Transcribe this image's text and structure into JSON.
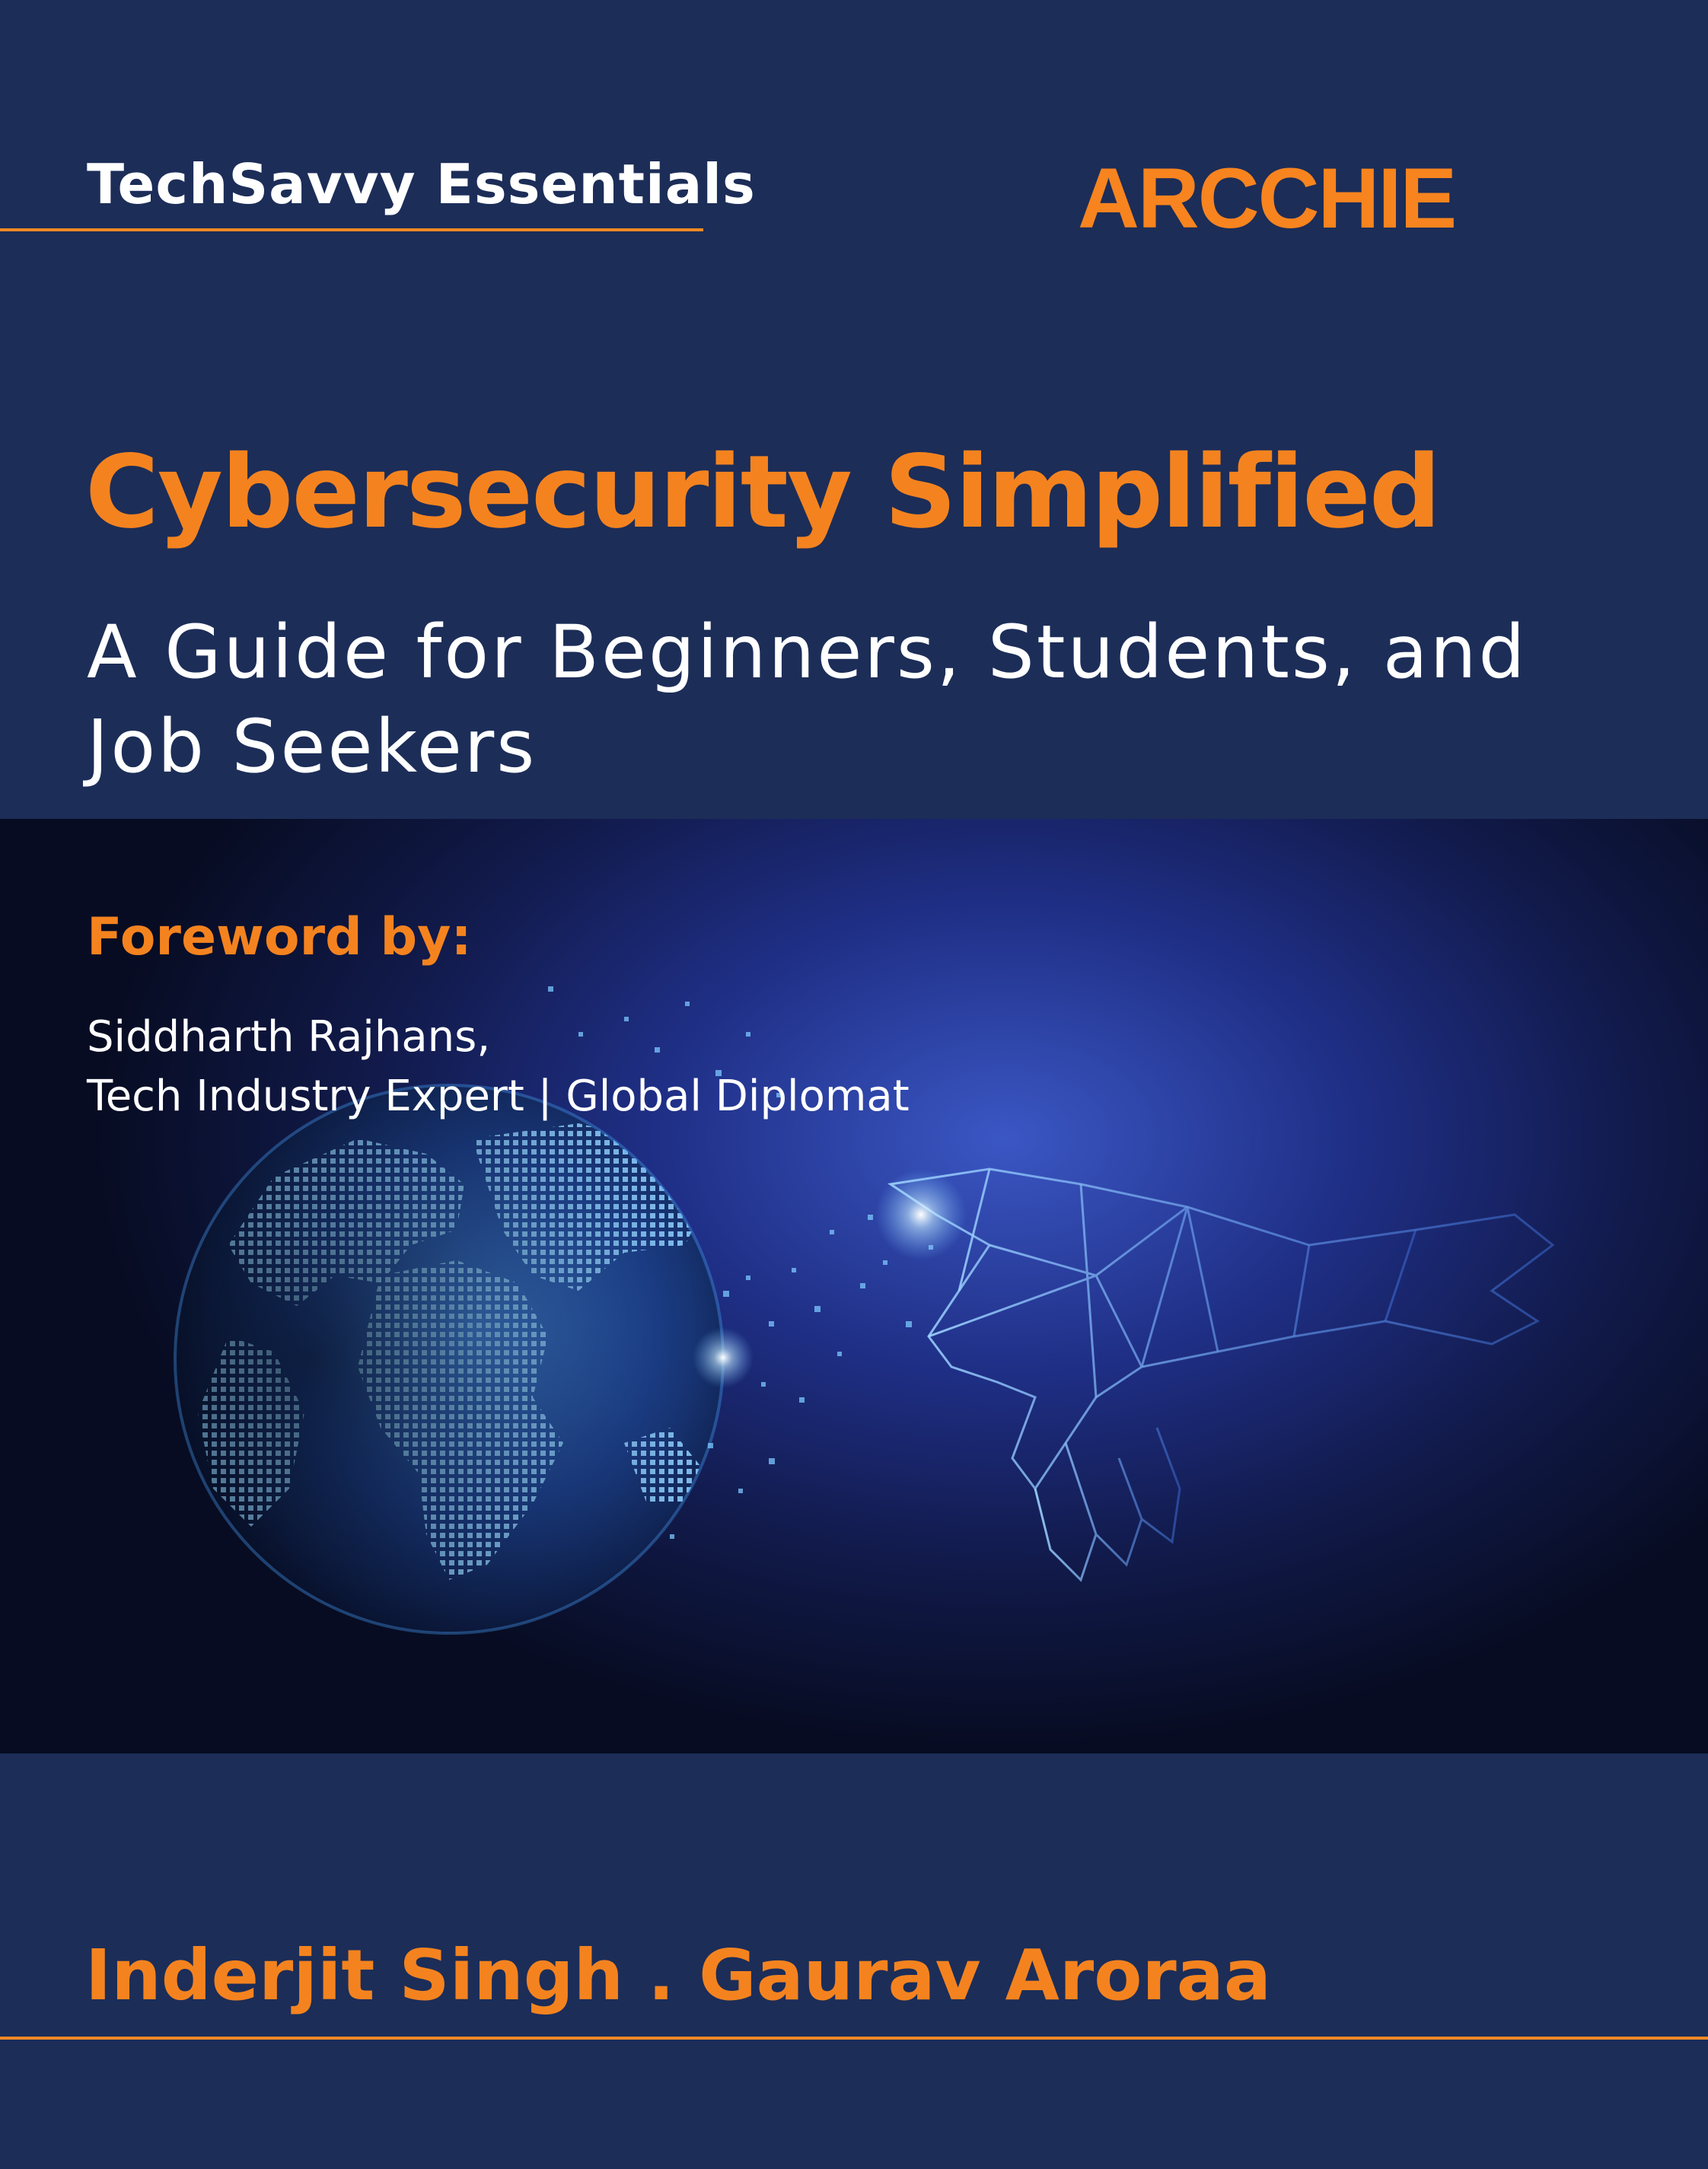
{
  "cover": {
    "series": "TechSavvy Essentials",
    "publisher": "ARCCHIE",
    "title": "Cybersecurity Simplified",
    "subtitle_line1": "A Guide for Beginners, Students, and",
    "subtitle_line2": "Job Seekers",
    "foreword_heading": "Foreword by:",
    "foreword_name": "Siddharth Rajhans,",
    "foreword_role": "Tech Industry Expert | Global Diplomat",
    "authors": "Inderjit Singh . Gaurav Aroraa"
  },
  "colors": {
    "background": "#1c2d58",
    "accent": "#f4831f",
    "text": "#ffffff"
  }
}
